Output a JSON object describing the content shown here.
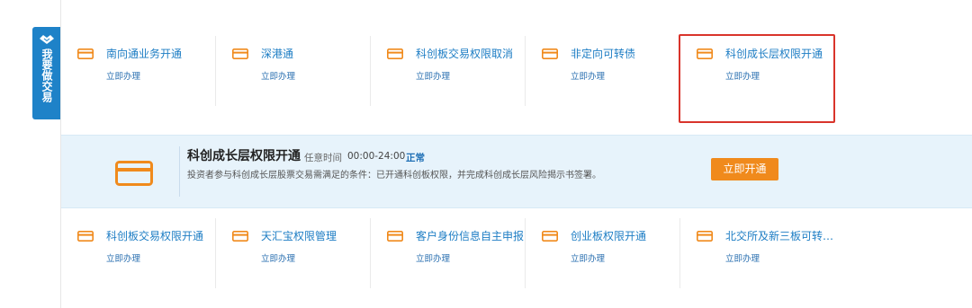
{
  "side_tab": {
    "label": "我要做交易",
    "icon": "handshake-icon"
  },
  "top_row": [
    {
      "name": "南向通业务开通",
      "action": "立即办理"
    },
    {
      "name": "深港通",
      "action": "立即办理"
    },
    {
      "name": "科创板交易权限取消",
      "action": "立即办理"
    },
    {
      "name": "非定向可转债",
      "action": "立即办理"
    },
    {
      "name": "科创成长层权限开通",
      "action": "立即办理"
    }
  ],
  "detail": {
    "title": "科创成长层权限开通",
    "time_label": "任意时间",
    "time_value": "00:00-24:00",
    "status": "正常",
    "description": "投资者参与科创成长层股票交易需满足的条件：已开通科创板权限，并完成科创成长层风险揭示书签署。",
    "button_label": "立即开通"
  },
  "bottom_row": [
    {
      "name": "科创板交易权限开通",
      "action": "立即办理"
    },
    {
      "name": "天汇宝权限管理",
      "action": "立即办理"
    },
    {
      "name": "客户身份信息自主申报",
      "action": "立即办理"
    },
    {
      "name": "创业板权限开通",
      "action": "立即办理"
    },
    {
      "name": "北交所及新三板可转…",
      "action": "立即办理"
    }
  ],
  "colors": {
    "accent": "#1e82c8",
    "link": "#1d7dc4",
    "orange": "#f08a1c",
    "highlight_border": "#d9342b",
    "detail_bg": "#e7f3fb"
  },
  "icons": {
    "service": "card-icon"
  }
}
